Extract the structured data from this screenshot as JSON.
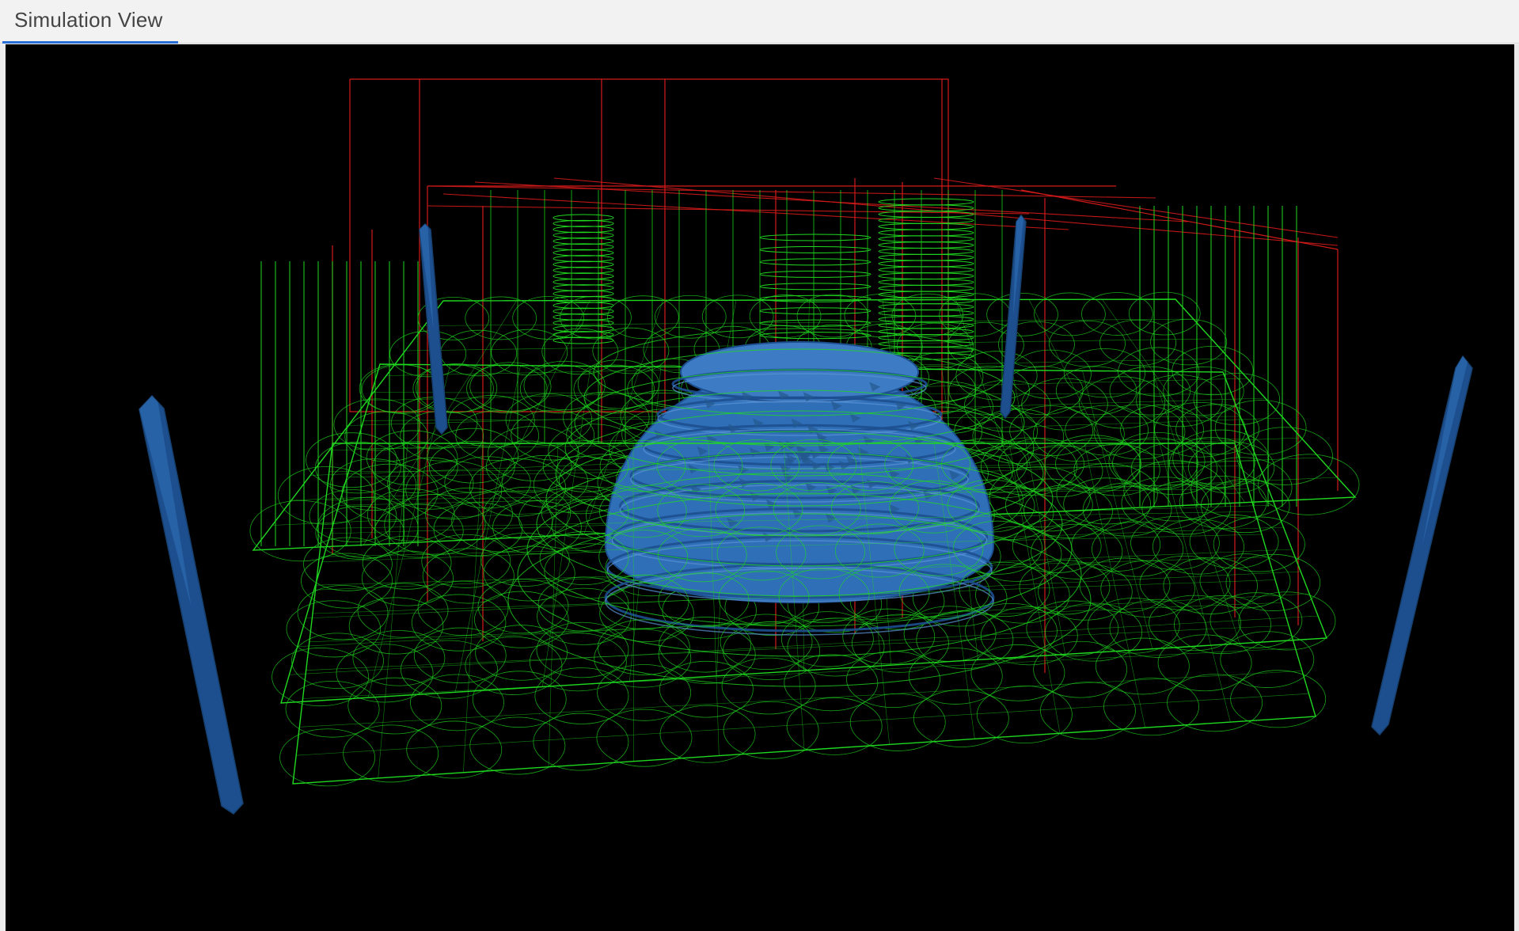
{
  "tabs": [
    {
      "label": "Simulation View",
      "active": true
    }
  ],
  "scene": {
    "background": "#000000",
    "wire_green": "#1fd81f",
    "wire_red": "#d41a1a",
    "solid_blue": "#2f6fb8",
    "solid_blue_dark": "#1d4f8f"
  }
}
